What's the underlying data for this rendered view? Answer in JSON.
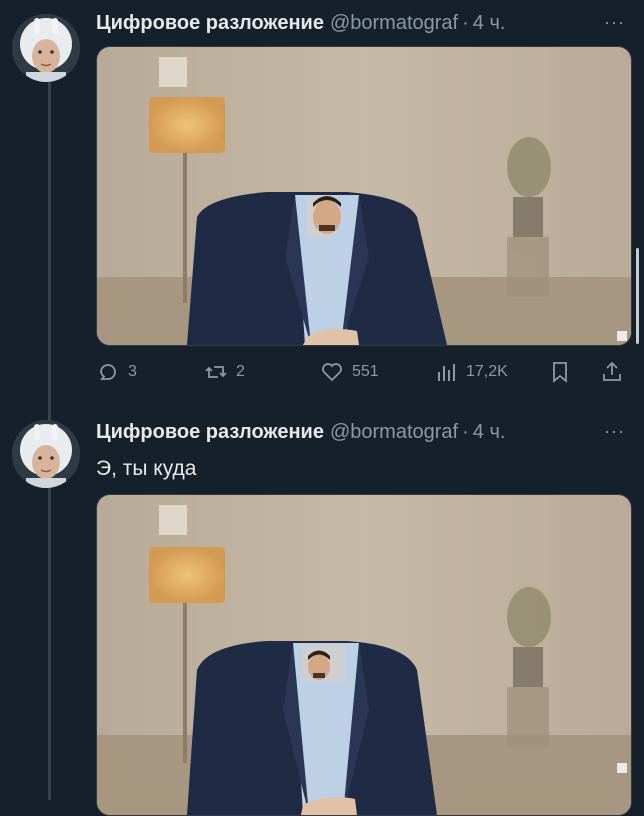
{
  "tweets": [
    {
      "author_name": "Цифровое разложение",
      "handle": "@bormatograf",
      "separator": "·",
      "time": "4 ч.",
      "more": "···",
      "text": "",
      "actions": {
        "replies": "3",
        "retweets": "2",
        "likes": "551",
        "views": "17,2K"
      }
    },
    {
      "author_name": "Цифровое разложение",
      "handle": "@bormatograf",
      "separator": "·",
      "time": "4 ч.",
      "more": "···",
      "text": "Э, ты куда"
    }
  ],
  "icons": {
    "reply": "speech-bubble-icon",
    "retweet": "retweet-icon",
    "like": "heart-icon",
    "views": "bar-chart-icon",
    "bookmark": "bookmark-icon",
    "share": "share-icon"
  },
  "colors": {
    "background": "#15202b",
    "muted_text": "#8b98a5",
    "primary_text": "#e7e9ea",
    "thread_line": "#38444d"
  }
}
